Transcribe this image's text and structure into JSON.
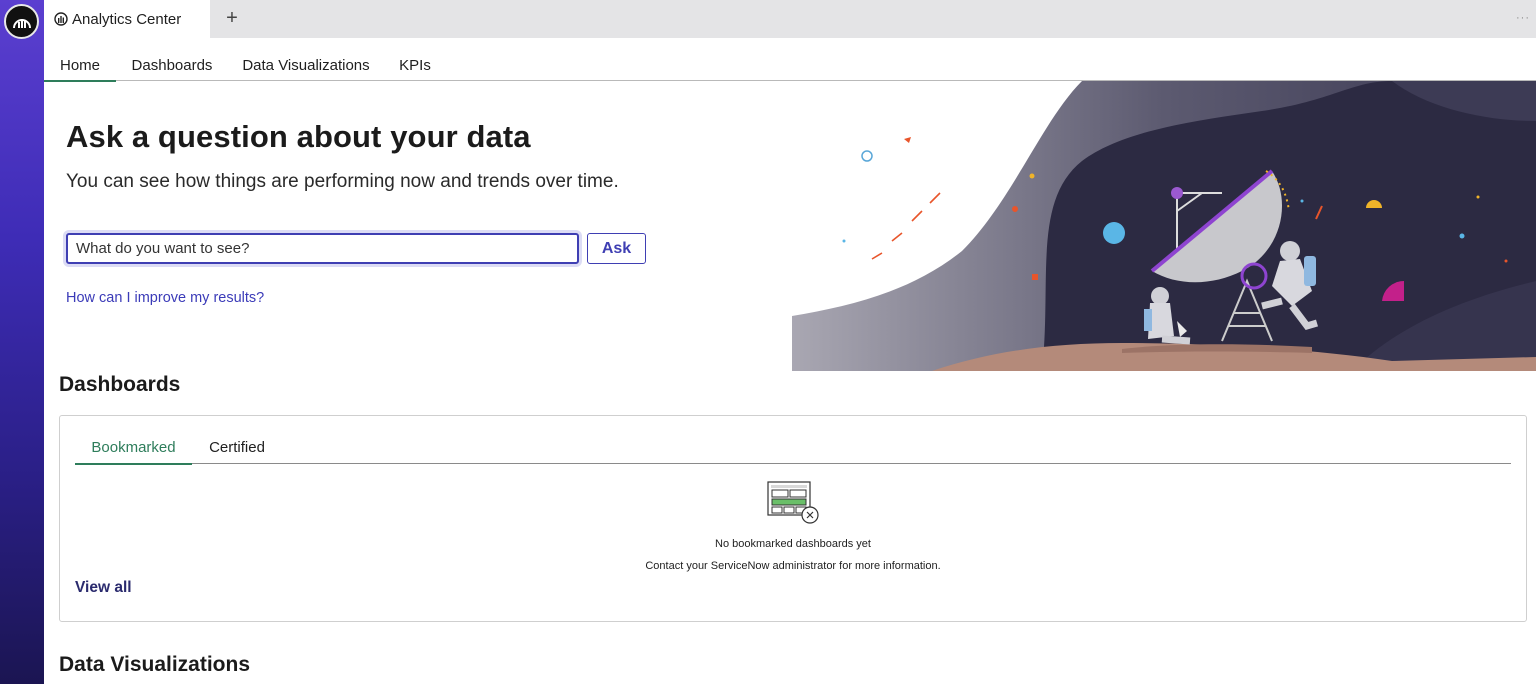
{
  "window": {
    "tab_title": "Analytics Center",
    "new_tab_symbol": "+",
    "more_symbol": "···",
    "app_icon": "analytics-gauge-icon"
  },
  "nav": {
    "tabs": [
      {
        "label": "Home",
        "active": true
      },
      {
        "label": "Dashboards",
        "active": false
      },
      {
        "label": "Data Visualizations",
        "active": false
      },
      {
        "label": "KPIs",
        "active": false
      }
    ]
  },
  "hero": {
    "title": "Ask a question about your data",
    "subtitle": "You can see how things are performing now and trends over time.",
    "search_placeholder": "What do you want to see?",
    "ask_label": "Ask",
    "help_link": "How can I improve my results?"
  },
  "dashboards": {
    "heading": "Dashboards",
    "tabs": [
      {
        "label": "Bookmarked",
        "active": true
      },
      {
        "label": "Certified",
        "active": false
      }
    ],
    "empty_title": "No bookmarked dashboards yet",
    "empty_message": "Contact your ServiceNow administrator for more information.",
    "view_all_label": "View all"
  },
  "data_visualizations": {
    "heading": "Data Visualizations"
  },
  "colors": {
    "accent": "#3f3fb3",
    "active_tab": "#2e7d5b",
    "rail_top": "#5b3fd0",
    "rail_bottom": "#1b1552"
  }
}
